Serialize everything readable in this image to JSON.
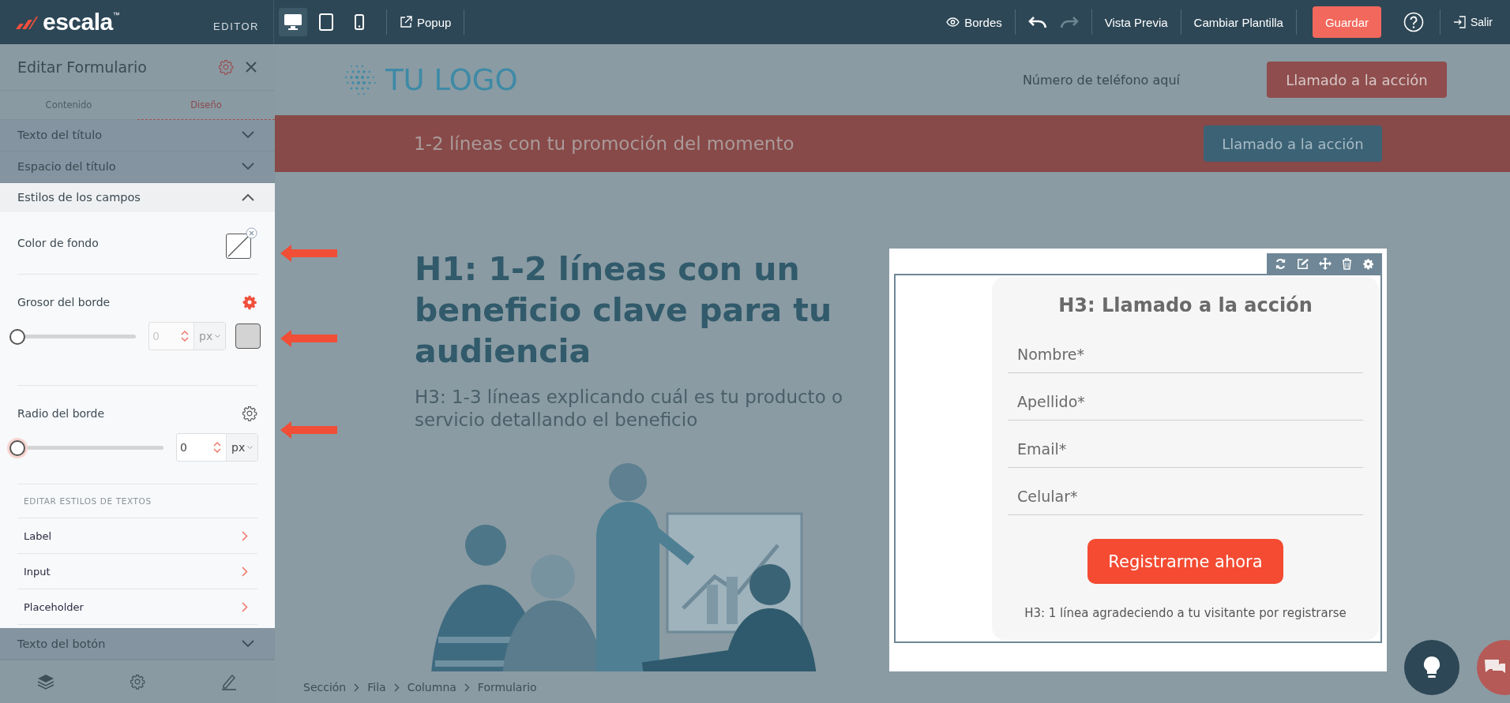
{
  "topbar": {
    "logo": "escala",
    "trademark": "™",
    "mode_label": "EDITOR",
    "devices": [
      {
        "kind": "desktop",
        "selected": true
      },
      {
        "kind": "tablet",
        "selected": false
      },
      {
        "kind": "mobile",
        "selected": false
      }
    ],
    "popup": "Popup",
    "borders": "Bordes",
    "undo": {
      "disabled": false
    },
    "redo": {
      "disabled": true
    },
    "preview": "Vista Previa",
    "change_template": "Cambiar Plantilla",
    "save": "Guardar",
    "exit": "Salir"
  },
  "panel": {
    "title": "Editar Formulario",
    "tabs": [
      {
        "label": "Contenido",
        "selected": false
      },
      {
        "label": "Diseño",
        "selected": true
      }
    ],
    "sections": [
      {
        "label": "Texto del título",
        "expanded": false
      },
      {
        "label": "Espacio del título",
        "expanded": false
      },
      {
        "label": "Estilos de los campos",
        "expanded": true
      },
      {
        "label": "Texto del botón",
        "expanded": false
      }
    ],
    "field_styles": {
      "background_color_label": "Color de fondo",
      "border_width": {
        "label": "Grosor del borde",
        "level": 0,
        "value": "0",
        "unit": "px",
        "disabled": true
      },
      "border_radius": {
        "label": "Radio del borde",
        "level": 0,
        "value": "0",
        "unit": "px",
        "disabled": false
      },
      "text_styles_heading": "EDITAR ESTILOS DE TEXTOS",
      "text_styles": [
        "Label",
        "Input",
        "Placeholder"
      ]
    }
  },
  "canvas": {
    "logo": "TU LOGO",
    "phone": "Número de teléfono aquí",
    "header_cta": "Llamado a la acción",
    "promo": "1-2 líneas con tu promoción del momento",
    "promo_cta": "Llamado a la acción",
    "h1": "H1: 1-2 líneas con un beneficio clave para tu audiencia",
    "h3": "H3: 1-3 líneas explicando cuál es tu producto o servicio detallando el beneficio",
    "form": {
      "title": "H3: Llamado a la acción",
      "fields": [
        {
          "placeholder": "Nombre*"
        },
        {
          "placeholder": "Apellido*"
        },
        {
          "placeholder": "Email*"
        },
        {
          "placeholder": "Celular*"
        }
      ],
      "submit": "Registrarme ahora",
      "footer": "H3: 1 línea agradeciendo a tu visitante por registrarse"
    }
  },
  "breadcrumbs": [
    "Sección",
    "Fila",
    "Columna",
    "Formulario"
  ]
}
